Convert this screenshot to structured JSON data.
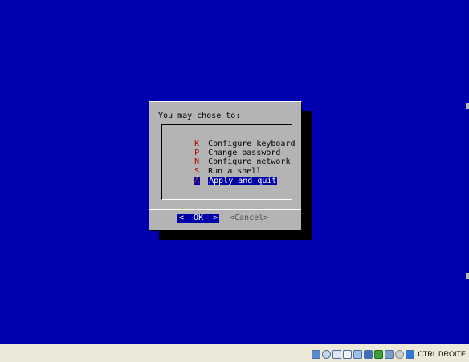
{
  "dialog": {
    "prompt": "You may chose to:",
    "menu": [
      {
        "key": "K",
        "label": "Configure keyboard",
        "selected": false
      },
      {
        "key": "P",
        "label": "Change password",
        "selected": false
      },
      {
        "key": "N",
        "label": "Configure network",
        "selected": false
      },
      {
        "key": "S",
        "label": "Run a shell",
        "selected": false
      },
      {
        "key": "A",
        "label": "Apply and quit",
        "selected": true
      }
    ],
    "ok_label": "<  OK  >",
    "cancel_label": "<Cancel>"
  },
  "taskbar": {
    "host_key_label": "CTRL DROITE",
    "tray_icons": [
      "hard-disk-icon",
      "optical-drive-icon",
      "usb-icon",
      "shared-folders-icon",
      "display-icon",
      "network-icon",
      "network-activity-icon",
      "video-capture-icon",
      "cpu-icon",
      "mouse-integration-icon"
    ]
  },
  "colors": {
    "screen_background": "#0000b0",
    "dialog_background": "#b4b4b4",
    "selection": "#0000a8",
    "hotkey": "#b00000"
  }
}
